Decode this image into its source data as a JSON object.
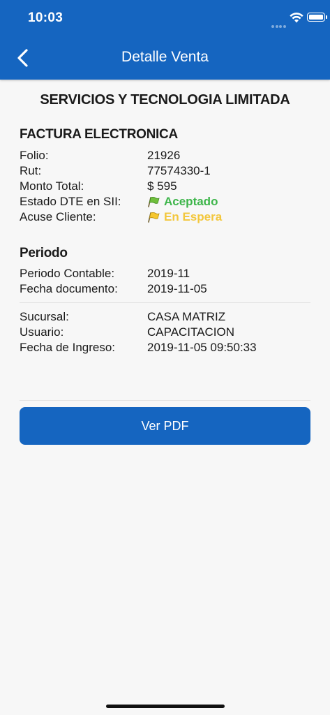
{
  "status_bar": {
    "time": "10:03"
  },
  "header": {
    "title": "Detalle Venta",
    "back_icon": "chevron-left-icon"
  },
  "company": "SERVICIOS Y TECNOLOGIA LIMITADA",
  "invoice": {
    "section_title": "FACTURA ELECTRONICA",
    "folio_label": "Folio:",
    "folio": "21926",
    "rut_label": "Rut:",
    "rut": "77574330-1",
    "monto_label": "Monto Total:",
    "monto": "$ 595",
    "estado_label": "Estado DTE en SII:",
    "estado": "Aceptado",
    "estado_color": "#3db54a",
    "acuse_label": "Acuse Cliente:",
    "acuse": "En Espera",
    "acuse_color": "#f3c73c"
  },
  "periodo": {
    "section_title": "Periodo",
    "contable_label": "Periodo Contable:",
    "contable": "2019-11",
    "fecha_doc_label": "Fecha documento:",
    "fecha_doc": "2019-11-05"
  },
  "extra": {
    "sucursal_label": "Sucursal:",
    "sucursal": "CASA MATRIZ",
    "usuario_label": "Usuario:",
    "usuario": "CAPACITACION",
    "ingreso_label": "Fecha de Ingreso:",
    "ingreso": "2019-11-05 09:50:33"
  },
  "actions": {
    "pdf_label": "Ver PDF"
  },
  "colors": {
    "primary": "#1565c0"
  }
}
